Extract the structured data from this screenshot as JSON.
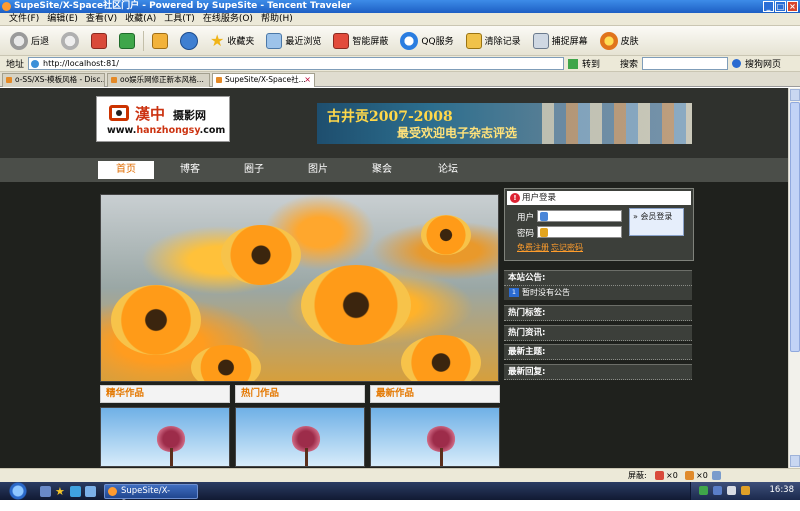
{
  "window": {
    "title": "SupeSite/X-Space社区门户 - Powered by SupeSite - Tencent Traveler"
  },
  "menu": [
    "文件(F)",
    "编辑(E)",
    "查看(V)",
    "收藏(A)",
    "工具(T)",
    "在线服务(O)",
    "帮助(H)"
  ],
  "toolbar": {
    "back": "后退",
    "favorites": "收藏夹",
    "recent": "最近浏览",
    "smart_screen": "智能屏蔽",
    "qq_service": "QQ服务",
    "clear_history": "清除记录",
    "capture": "捕捉屏幕",
    "skin": "皮肤"
  },
  "address": {
    "label": "地址",
    "url": "http://localhost:81/",
    "go": "转到",
    "search_label": "搜索",
    "search_engine": "搜狗网页"
  },
  "tabs": [
    {
      "label": "o-SS/XS-模板风格 - Disc..."
    },
    {
      "label": "oo娱乐网修正新本风格..."
    },
    {
      "label": "SupeSite/X-Space社..."
    }
  ],
  "site": {
    "logo_cn": "漢中",
    "logo_cn2": "摄影网",
    "logo_url_prefix": "www.",
    "logo_url_mid": "hanzhongsy",
    "logo_url_suffix": ".com",
    "banner_line1": "古井贡2007-2008",
    "banner_line2": "最受欢迎电子杂志评选",
    "nav": [
      "首页",
      "博客",
      "圈子",
      "图片",
      "聚会",
      "论坛"
    ],
    "sections": [
      "精华作品",
      "热门作品",
      "最新作品"
    ],
    "login": {
      "title": "用户登录",
      "user_label": "用户",
      "pass_label": "密码",
      "button": "会员登录",
      "register": "免费注册",
      "forgot": "忘记密码"
    },
    "panels": {
      "notice_title": "本站公告:",
      "notice_text": "暂时没有公告",
      "hot_tags": "热门标签:",
      "hot_news": "热门资讯:",
      "latest_topics": "最新主题:",
      "latest_replies": "最新回复:"
    }
  },
  "statusbar": {
    "screen_label": "屏蔽:",
    "count1": "×0",
    "count2": "×0"
  },
  "taskbar": {
    "task_label": "SupeSite/X-Space...",
    "clock": "16:38"
  },
  "colors": {
    "accent_orange": "#e47800",
    "page_bg": "#1f211d",
    "nav_bg": "#4b4e49"
  }
}
